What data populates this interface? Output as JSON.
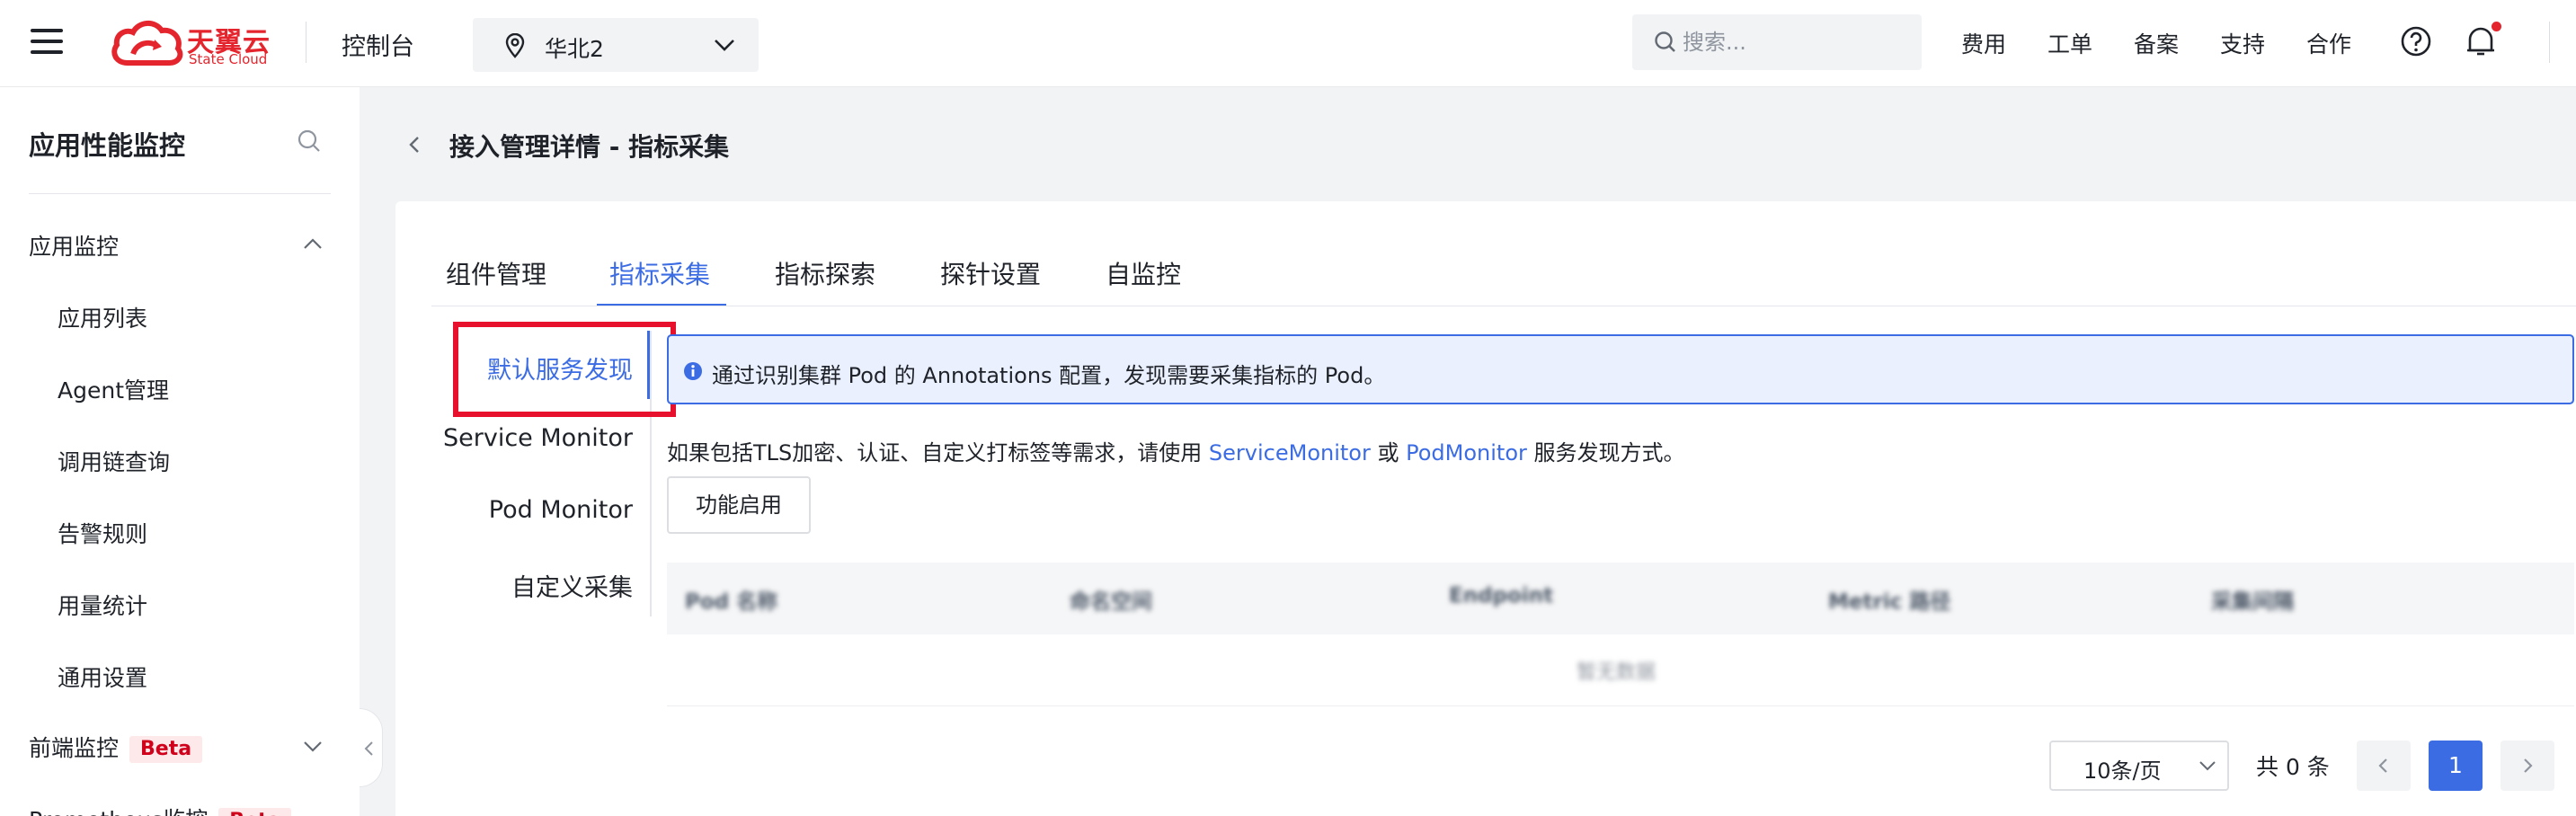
{
  "header": {
    "logo_cn": "天翼云",
    "logo_en": "State Cloud",
    "console": "控制台",
    "region": "华北2",
    "search_placeholder": "搜索...",
    "nav": [
      "费用",
      "工单",
      "备案",
      "支持",
      "合作"
    ]
  },
  "sidebar": {
    "title": "应用性能监控",
    "group_app": "应用监控",
    "items": [
      "应用列表",
      "Agent管理",
      "调用链查询",
      "告警规则",
      "用量统计",
      "通用设置"
    ],
    "group_frontend": "前端监控",
    "group_frontend_badge": "Beta",
    "group_cut": "Prometheus监控"
  },
  "page": {
    "title": "接入管理详情 - 指标采集"
  },
  "tabs": [
    "组件管理",
    "指标采集",
    "指标探索",
    "探针设置",
    "自监控"
  ],
  "vtabs": [
    "默认服务发现",
    "Service Monitor",
    "Pod Monitor",
    "自定义采集"
  ],
  "alert": "通过识别集群 Pod 的 Annotations 配置，发现需要采集指标的 Pod。",
  "hint": {
    "prefix": "如果包括TLS加密、认证、自定义打标签等需求，请使用 ",
    "link1": "ServiceMonitor",
    "mid": " 或 ",
    "link2": "PodMonitor",
    "suffix": " 服务发现方式。"
  },
  "enable_button": "功能启用",
  "table": {
    "columns": [
      "Pod 名称",
      "命名空间",
      "Endpoint",
      "Metric 路径",
      "采集间隔"
    ],
    "empty": "暂无数据"
  },
  "pagination": {
    "page_size": "10条/页",
    "total": "共 0 条",
    "current": "1"
  },
  "colors": {
    "primary": "#3b6ce3",
    "brand_red": "#e4252d",
    "highlight_box": "#e8112d"
  }
}
